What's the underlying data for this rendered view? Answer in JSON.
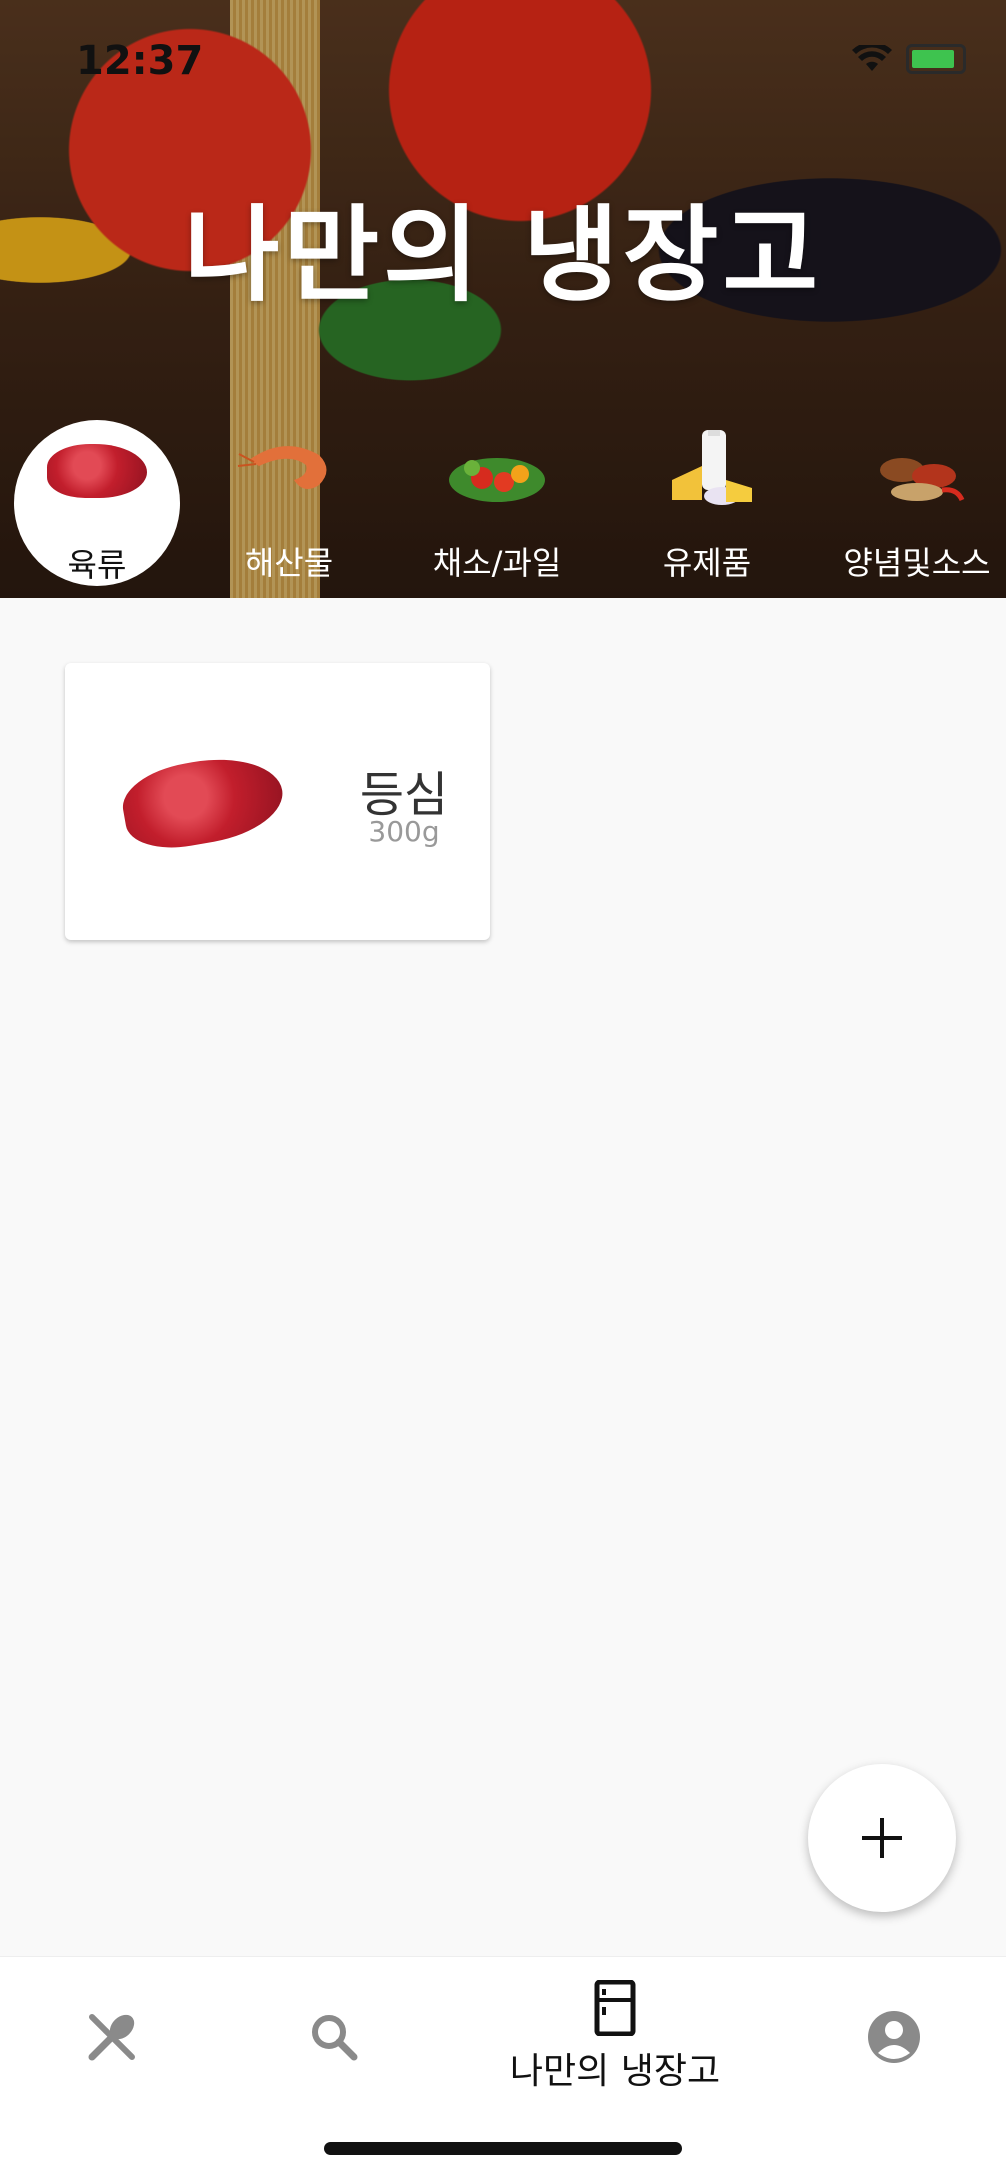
{
  "status": {
    "time": "12:37"
  },
  "header": {
    "title": "나만의 냉장고"
  },
  "categories": [
    {
      "label": "육류",
      "active": true
    },
    {
      "label": "해산물",
      "active": false
    },
    {
      "label": "채소/과일",
      "active": false
    },
    {
      "label": "유제품",
      "active": false
    },
    {
      "label": "양념및소스",
      "active": false
    }
  ],
  "items": [
    {
      "name": "등심",
      "quantity": "300g"
    }
  ],
  "fab": {
    "icon": "plus-icon",
    "label": "+"
  },
  "bottom_nav": [
    {
      "icon": "utensils-icon",
      "label": ""
    },
    {
      "icon": "search-icon",
      "label": ""
    },
    {
      "icon": "fridge-icon",
      "label": "나만의 냉장고",
      "active": true
    },
    {
      "icon": "account-icon",
      "label": ""
    }
  ],
  "colors": {
    "active_tab": "#111111",
    "inactive_tab": "#8a8a8a",
    "battery": "#3ec34f"
  }
}
